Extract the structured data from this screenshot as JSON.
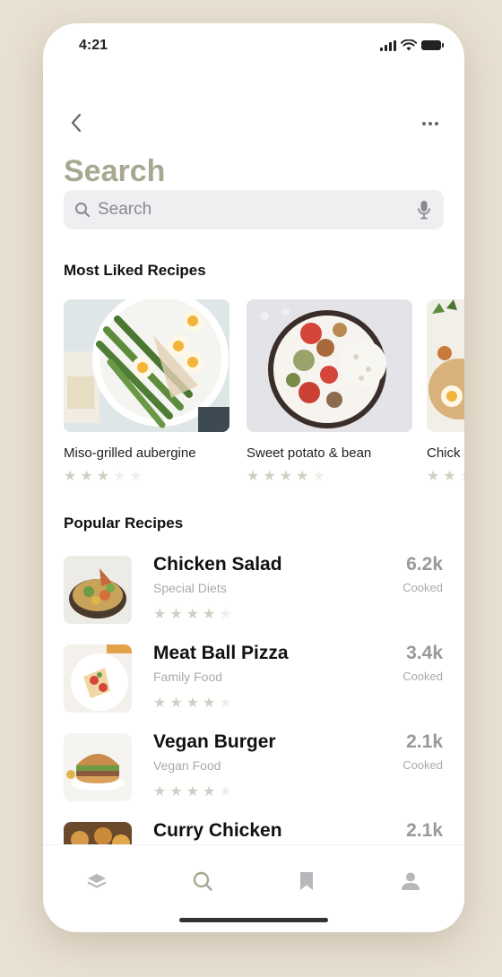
{
  "status_bar": {
    "time": "4:21"
  },
  "nav": {
    "back_icon": "chevron-left-icon",
    "more_icon": "more-horizontal-icon"
  },
  "page": {
    "title": "Search"
  },
  "search": {
    "placeholder": "Search",
    "value": "",
    "icon": "search-icon",
    "mic_icon": "microphone-icon"
  },
  "most_liked": {
    "title": "Most Liked Recipes",
    "items": [
      {
        "name": "Miso-grilled aubergine",
        "rating": 3,
        "max": 5
      },
      {
        "name": "Sweet potato & bean",
        "rating": 4,
        "max": 5
      },
      {
        "name": "Chick",
        "rating": 2,
        "max": 5
      }
    ]
  },
  "popular": {
    "title": "Popular Recipes",
    "items": [
      {
        "name": "Chicken Salad",
        "category": "Special Diets",
        "count": "6.2k",
        "count_label": "Cooked",
        "rating": 4,
        "max": 5
      },
      {
        "name": "Meat Ball Pizza",
        "category": "Family Food",
        "count": "3.4k",
        "count_label": "Cooked",
        "rating": 4,
        "max": 5
      },
      {
        "name": "Vegan Burger",
        "category": "Vegan Food",
        "count": "2.1k",
        "count_label": "Cooked",
        "rating": 4,
        "max": 5
      },
      {
        "name": "Curry Chicken",
        "category": "",
        "count": "2.1k",
        "count_label": "",
        "rating": 0,
        "max": 5
      }
    ]
  },
  "tab_bar": {
    "tabs": [
      {
        "icon": "layers-icon",
        "active": false
      },
      {
        "icon": "search-icon",
        "active": true
      },
      {
        "icon": "bookmark-icon",
        "active": false
      },
      {
        "icon": "profile-icon",
        "active": false
      }
    ]
  },
  "colors": {
    "title": "#a8a890",
    "background": "#e8e0d2",
    "search_bg": "#efeff2",
    "star_filled": "#cfcfc3",
    "star_empty": "#efefea"
  }
}
